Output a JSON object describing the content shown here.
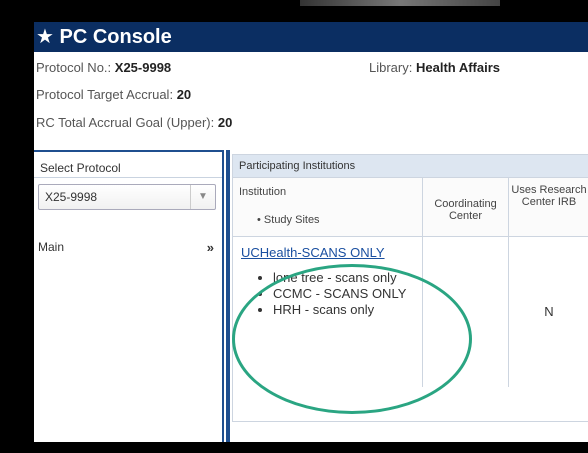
{
  "header": {
    "title": "PC Console",
    "star": "★"
  },
  "info": {
    "protocol_label": "Protocol No.:",
    "protocol_value": "X25-9998",
    "library_label": "Library:",
    "library_value": "Health Affairs",
    "target_label": "Protocol Target Accrual:",
    "target_value": "20",
    "rc_label": "RC Total Accrual Goal (Upper):",
    "rc_value": "20"
  },
  "sidebar": {
    "select_label": "Select Protocol",
    "selected_value": "X25-9998",
    "main_label": "Main",
    "main_chevron": "»"
  },
  "table": {
    "caption": "Participating Institutions",
    "headers": {
      "institution": "Institution",
      "study_sites": "Study Sites",
      "coordinating": "Coordinating Center",
      "uses_irb": "Uses Research Center IRB"
    },
    "rows": [
      {
        "institution": "UCHealth-SCANS ONLY",
        "sites": [
          "lone tree - scans only",
          "CCMC - SCANS ONLY",
          "HRH - scans only"
        ],
        "coordinating": "",
        "uses_irb": "N"
      }
    ]
  },
  "colors": {
    "header_bg": "#0b2e62",
    "highlight": "#2aa582",
    "link": "#1a4fa0"
  }
}
